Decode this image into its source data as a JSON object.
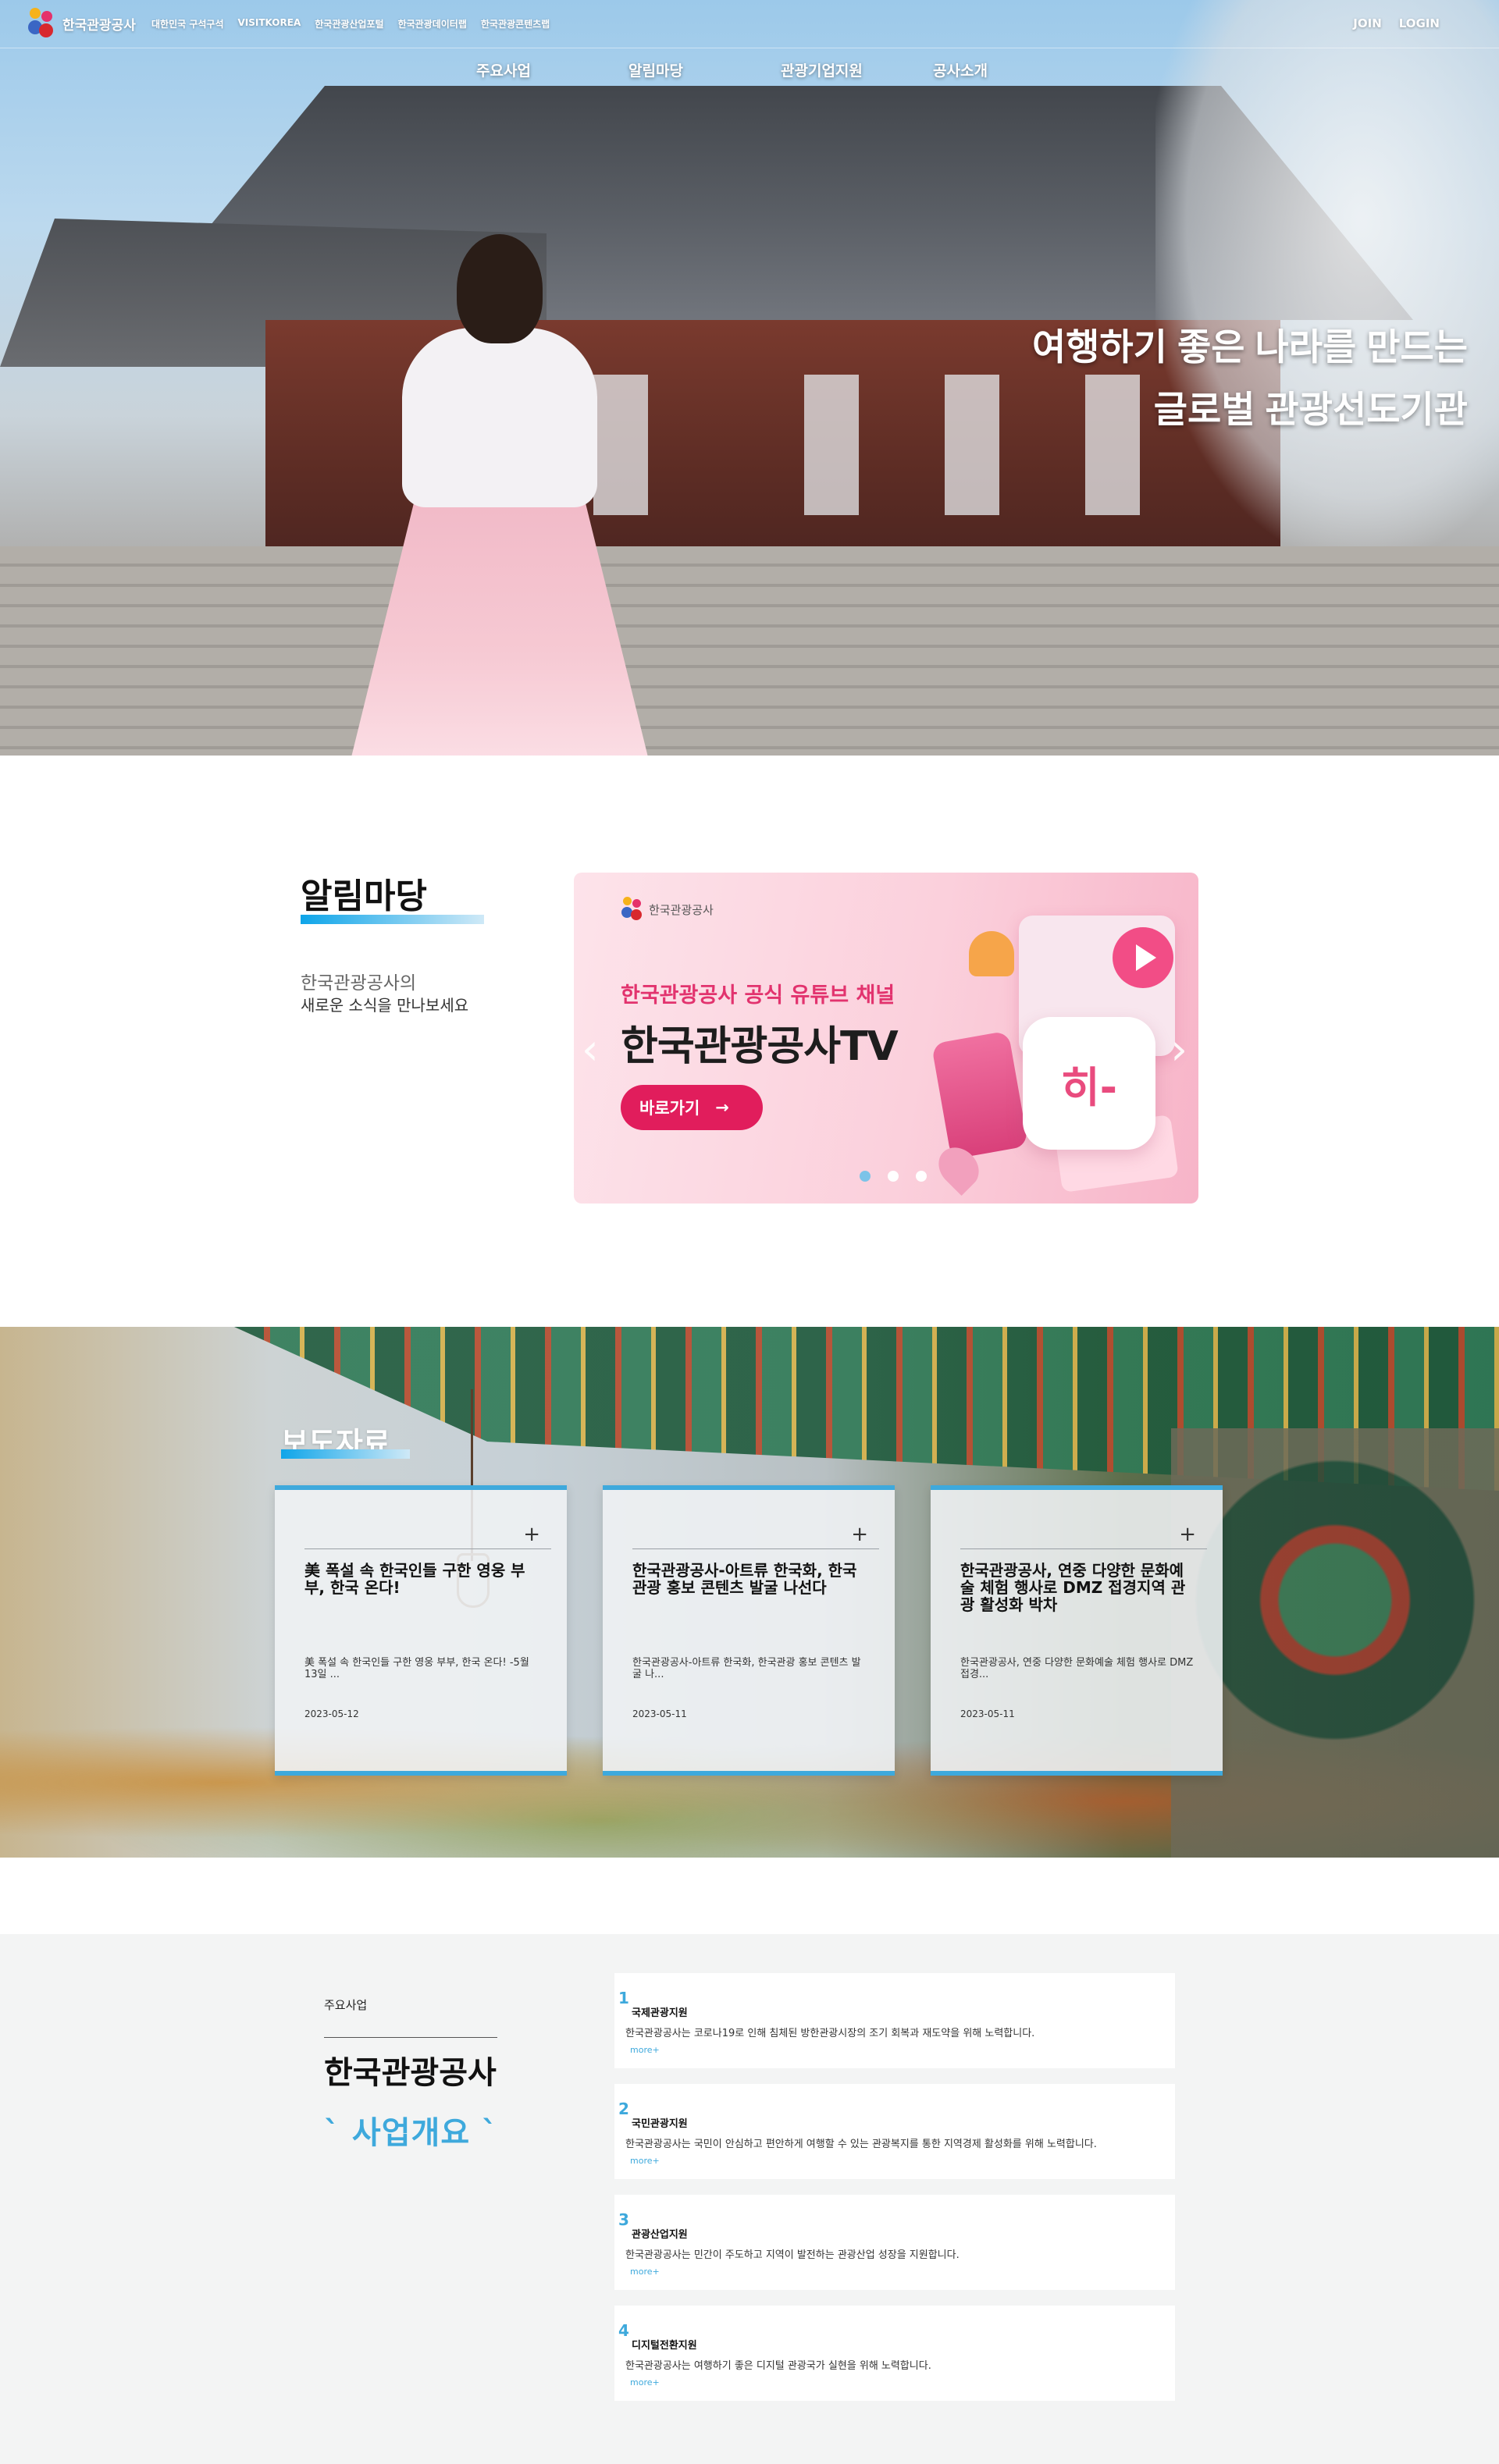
{
  "header": {
    "logo_text": "한국관광공사",
    "site_links": [
      "대한민국 구석구석",
      "VISITKOREA",
      "한국관광산업포털",
      "한국관광데이터랩",
      "한국관광콘텐츠랩"
    ],
    "auth": {
      "join": "JOIN",
      "login": "LOGIN"
    },
    "gnb": [
      "주요사업",
      "알림마당",
      "관광기업지원",
      "공사소개"
    ]
  },
  "hero": {
    "line1": "여행하기 좋은 나라를 만드는",
    "line2": "글로벌 관광선도기관"
  },
  "notice": {
    "title": "알림마당",
    "sub1": "한국관광공사의",
    "sub2": "새로운 소식을 만나보세요",
    "banner": {
      "logo_text": "한국관광공사",
      "subtitle": "한국관광공사 공식 유튜브 채널",
      "title": "한국관광공사TV",
      "button": "바로가기",
      "button_icon": "arrow-right-icon",
      "flower_text": "히-",
      "prev_icon": "chevron-left-icon",
      "next_icon": "chevron-right-icon",
      "dots": 3,
      "active_dot": 1
    }
  },
  "press": {
    "title": "보도자료",
    "items": [
      {
        "title": "美 폭설 속 한국인들 구한 영웅 부부, 한국 온다!",
        "desc": "美 폭설 속 한국인들 구한 영웅 부부, 한국 온다! -5월 13일 ...",
        "date": "2023-05-12"
      },
      {
        "title": "한국관광공사-아트류 한국화, 한국관광 홍보 콘텐츠 발굴 나선다",
        "desc": "한국관광공사-아트류 한국화, 한국관광 홍보 콘텐츠 발굴 나...",
        "date": "2023-05-11"
      },
      {
        "title": "한국관광공사, 연중 다양한 문화예술 체험 행사로 DMZ 접경지역 관광 활성화 박차",
        "desc": "한국관광공사, 연중 다양한 문화예술 체험 행사로 DMZ 접경...",
        "date": "2023-05-11"
      }
    ]
  },
  "business": {
    "label": "주요사업",
    "title": "한국관광공사",
    "subtitle": "` 사업개요 `",
    "items": [
      {
        "num": "1",
        "name": "국제관광지원",
        "desc": "한국관광공사는 코로나19로 인해 침체된 방한관광시장의 조기 회복과 재도약을 위해 노력합니다.",
        "more": "more+"
      },
      {
        "num": "2",
        "name": "국민관광지원",
        "desc": "한국관광공사는 국민이 안심하고 편안하게 여행할 수 있는 관광복지를 통한 지역경제 활성화를 위해 노력합니다.",
        "more": "more+"
      },
      {
        "num": "3",
        "name": "관광산업지원",
        "desc": "한국관광공사는 민간이 주도하고 지역이 발전하는 관광산업 성장을 지원합니다.",
        "more": "more+"
      },
      {
        "num": "4",
        "name": "디지털전환지원",
        "desc": "한국관광공사는 여행하기 좋은 디지털 관광국가 실현을 위해 노력합니다.",
        "more": "more+"
      }
    ]
  },
  "colors": {
    "accent": "#3ea9dc",
    "banner_pink": "#e11d5c",
    "title_gradient": [
      "#0ea5e9",
      "#cfe9f7"
    ]
  }
}
